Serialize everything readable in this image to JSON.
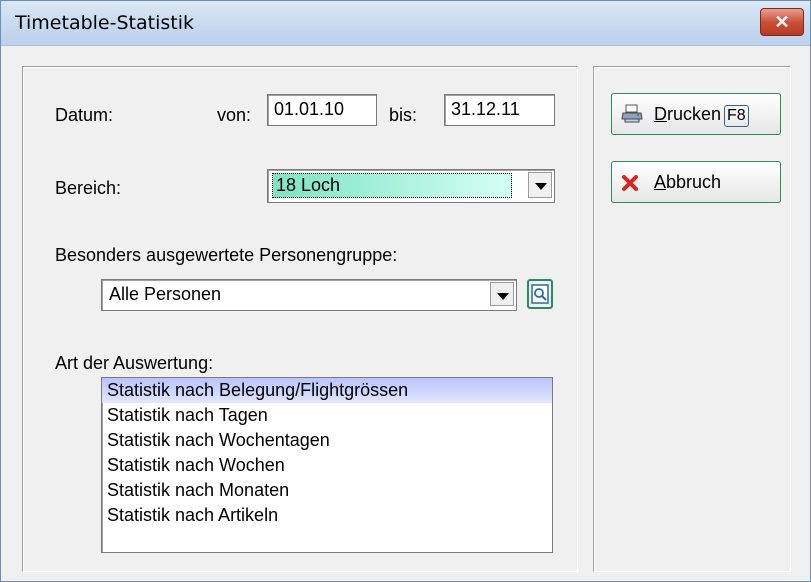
{
  "window": {
    "title": "Timetable-Statistik",
    "close_glyph": "✕"
  },
  "datum": {
    "label": "Datum:",
    "von_label": "von:",
    "von_value": "01.01.10",
    "bis_label": "bis:",
    "bis_value": "31.12.11"
  },
  "bereich": {
    "label": "Bereich:",
    "value": "18 Loch"
  },
  "personengruppe": {
    "label": "Besonders ausgewertete Personengruppe:",
    "value": "Alle Personen"
  },
  "auswertung": {
    "label": "Art der Auswertung:",
    "items": [
      "Statistik nach Belegung/Flightgrössen",
      "Statistik nach Tagen",
      "Statistik nach Wochentagen",
      "Statistik nach Wochen",
      "Statistik nach Monaten",
      "Statistik nach Artikeln"
    ],
    "selected_index": 0
  },
  "buttons": {
    "drucken": {
      "accel": "D",
      "rest": "rucken",
      "fkey": "F8",
      "icon": "printer-icon"
    },
    "abbruch": {
      "accel": "A",
      "rest": "bbruch",
      "icon": "cancel-x-icon"
    }
  },
  "colors": {
    "titlebar": "#c5d8ee",
    "selection": "#b8c4fb",
    "combo_highlight": "#7fe3c6",
    "button_border": "#2d8a5a",
    "cancel_red": "#d9261c"
  }
}
